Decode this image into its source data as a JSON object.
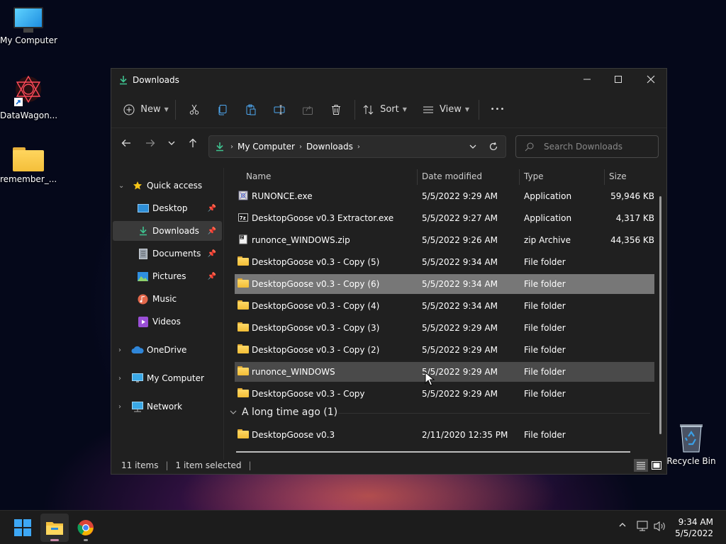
{
  "desktop": {
    "icons": [
      {
        "label": "My Computer"
      },
      {
        "label": "DataWagon..."
      },
      {
        "label": "remember_..."
      },
      {
        "label": "Recycle Bin"
      }
    ]
  },
  "window": {
    "title": "Downloads",
    "toolbar": {
      "new_label": "New",
      "sort_label": "Sort",
      "view_label": "View",
      "more_label": "•••"
    },
    "address": {
      "crumbs": [
        "My Computer",
        "Downloads"
      ]
    },
    "search": {
      "placeholder": "Search Downloads"
    },
    "nav": {
      "quick_access": "Quick access",
      "items": [
        {
          "label": "Desktop"
        },
        {
          "label": "Downloads"
        },
        {
          "label": "Documents"
        },
        {
          "label": "Pictures"
        },
        {
          "label": "Music"
        },
        {
          "label": "Videos"
        }
      ],
      "onedrive": "OneDrive",
      "my_computer": "My Computer",
      "network": "Network"
    },
    "columns": {
      "name": "Name",
      "date": "Date modified",
      "type": "Type",
      "size": "Size"
    },
    "files": [
      {
        "name": "RUNONCE.exe",
        "date": "5/5/2022 9:29 AM",
        "type": "Application",
        "size": "59,946 KB",
        "icon": "exe-icon"
      },
      {
        "name": "DesktopGoose v0.3 Extractor.exe",
        "date": "5/5/2022 9:27 AM",
        "type": "Application",
        "size": "4,317 KB",
        "icon": "7zip-exe-icon"
      },
      {
        "name": "runonce_WINDOWS.zip",
        "date": "5/5/2022 9:26 AM",
        "type": "zip Archive",
        "size": "44,356 KB",
        "icon": "zip-icon"
      },
      {
        "name": "DesktopGoose v0.3 - Copy (5)",
        "date": "5/5/2022 9:34 AM",
        "type": "File folder",
        "size": "",
        "icon": "folder-icon"
      },
      {
        "name": "DesktopGoose v0.3 - Copy (6)",
        "date": "5/5/2022 9:34 AM",
        "type": "File folder",
        "size": "",
        "icon": "folder-icon"
      },
      {
        "name": "DesktopGoose v0.3 - Copy (4)",
        "date": "5/5/2022 9:34 AM",
        "type": "File folder",
        "size": "",
        "icon": "folder-icon"
      },
      {
        "name": "DesktopGoose v0.3 - Copy (3)",
        "date": "5/5/2022 9:29 AM",
        "type": "File folder",
        "size": "",
        "icon": "folder-icon"
      },
      {
        "name": "DesktopGoose v0.3 - Copy (2)",
        "date": "5/5/2022 9:29 AM",
        "type": "File folder",
        "size": "",
        "icon": "folder-icon"
      },
      {
        "name": "runonce_WINDOWS",
        "date": "5/5/2022 9:29 AM",
        "type": "File folder",
        "size": "",
        "icon": "folder-icon"
      },
      {
        "name": "DesktopGoose v0.3 - Copy",
        "date": "5/5/2022 9:29 AM",
        "type": "File folder",
        "size": "",
        "icon": "folder-icon"
      }
    ],
    "group": {
      "label": "A long time ago (1)"
    },
    "old_files": [
      {
        "name": "DesktopGoose v0.3",
        "date": "2/11/2020 12:35 PM",
        "type": "File folder",
        "size": "",
        "icon": "folder-icon"
      }
    ],
    "status": {
      "count": "11 items",
      "selected": "1 item selected"
    }
  },
  "taskbar": {
    "time": "9:34 AM",
    "date": "5/5/2022"
  }
}
